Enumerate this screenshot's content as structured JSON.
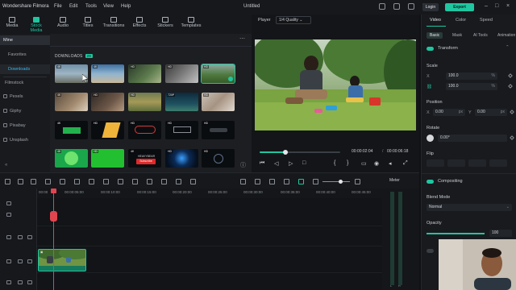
{
  "app": {
    "title": "Wondershare Filmora",
    "menu": [
      "File",
      "Edit",
      "Tools",
      "View",
      "Help"
    ],
    "project_title": "Untitled",
    "login_label": "Login",
    "export_label": "Export"
  },
  "toolbar": {
    "tabs": [
      {
        "label": "Media",
        "icon": "media-icon"
      },
      {
        "label": "Stock Media",
        "icon": "stock-media-icon",
        "active": true
      },
      {
        "label": "Audio",
        "icon": "audio-icon"
      },
      {
        "label": "Titles",
        "icon": "titles-icon"
      },
      {
        "label": "Transitions",
        "icon": "transitions-icon"
      },
      {
        "label": "Effects",
        "icon": "effects-icon"
      },
      {
        "label": "Stickers",
        "icon": "stickers-icon"
      },
      {
        "label": "Templates",
        "icon": "templates-icon"
      }
    ]
  },
  "sidebar": {
    "mine_label": "Mine",
    "items": [
      "Favorites",
      "Downloads",
      "Filmstock",
      "Pexels",
      "Giphy",
      "Pixabay",
      "Unsplash"
    ],
    "active": "Downloads"
  },
  "media": {
    "section_label": "DOWNLOADS",
    "count": "29",
    "thumb_tags": [
      "4K",
      "4K",
      "HD",
      "HD",
      "HD",
      "4K",
      "HD",
      "HD",
      "720P",
      "HD",
      "4K",
      "HD",
      "HD",
      "HD",
      "HD",
      "4K",
      "HD",
      "4K",
      "HD",
      "HD"
    ],
    "thumb_extra_texts": [
      "Subscribe",
      "HEAVYBEAR"
    ]
  },
  "player": {
    "label": "Player",
    "quality": "1/4 Quality",
    "current_time": "00:00:02:04",
    "total_time": "00:00:06:18",
    "progress": 0.32
  },
  "properties": {
    "tabs": [
      "Video",
      "Color",
      "Speed"
    ],
    "active_tab": "Video",
    "subtabs": [
      "Basic",
      "Mask",
      "AI Tools",
      "Animation"
    ],
    "active_subtab": "Basic",
    "transform_label": "Transform",
    "scale_label": "Scale",
    "scale_x": "100.0",
    "scale_y": "100.0",
    "scale_unit": "%",
    "position_label": "Position",
    "position_x_axis": "X",
    "position_y_axis": "Y",
    "position_x": "0.00",
    "position_y": "0.00",
    "position_unit": "px",
    "rotate_label": "Rotate",
    "rotate_value": "0.00°",
    "flip_label": "Flip",
    "compositing_label": "Compositing",
    "blend_mode_label": "Blend Mode",
    "blend_mode_value": "Normal",
    "opacity_label": "Opacity",
    "opacity_value": "100"
  },
  "timeline": {
    "meter_label": "Meter",
    "ruler_times": [
      "00:00",
      "00:00:05:00",
      "00:00:10:00",
      "00:00:15:00",
      "00:00:20:00",
      "00:00:25:00",
      "00:00:30:00",
      "00:00:35:00",
      "00:00:40:00",
      "00:00:45:00"
    ],
    "meter_scale": [
      "L",
      "R"
    ]
  },
  "colors": {
    "accent": "#1fc6a0",
    "playhead": "#e0454f",
    "link": "#3ab4e6"
  }
}
